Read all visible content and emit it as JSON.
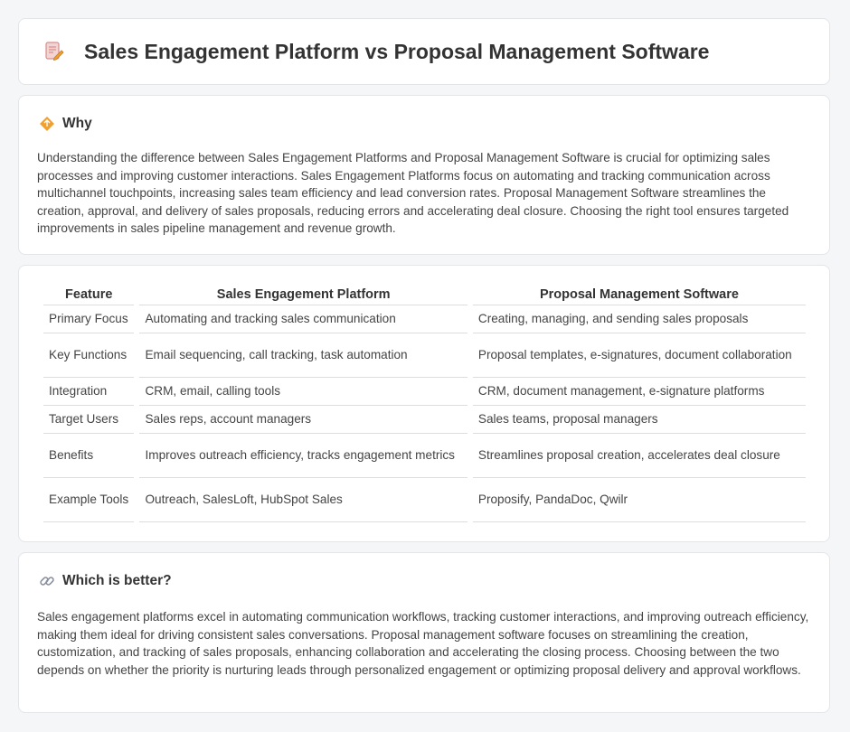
{
  "page": {
    "title": "Sales Engagement Platform vs Proposal Management Software"
  },
  "why": {
    "heading": "Why",
    "text": "Understanding the difference between Sales Engagement Platforms and Proposal Management Software is crucial for optimizing sales processes and improving customer interactions. Sales Engagement Platforms focus on automating and tracking communication across multichannel touchpoints, increasing sales team efficiency and lead conversion rates. Proposal Management Software streamlines the creation, approval, and delivery of sales proposals, reducing errors and accelerating deal closure. Choosing the right tool ensures targeted improvements in sales pipeline management and revenue growth."
  },
  "table": {
    "headers": [
      "Feature",
      "Sales Engagement Platform",
      "Proposal Management Software"
    ],
    "rows": [
      [
        "Primary Focus",
        "Automating and tracking sales communication",
        "Creating, managing, and sending sales proposals"
      ],
      [
        "Key Functions",
        "Email sequencing, call tracking, task automation",
        "Proposal templates, e-signatures, document collaboration"
      ],
      [
        "Integration",
        "CRM, email, calling tools",
        "CRM, document management, e-signature platforms"
      ],
      [
        "Target Users",
        "Sales reps, account managers",
        "Sales teams, proposal managers"
      ],
      [
        "Benefits",
        "Improves outreach efficiency, tracks engagement metrics",
        "Streamlines proposal creation, accelerates deal closure"
      ],
      [
        "Example Tools",
        "Outreach, SalesLoft, HubSpot Sales",
        "Proposify, PandaDoc, Qwilr"
      ]
    ]
  },
  "better": {
    "heading": "Which is better?",
    "text": "Sales engagement platforms excel in automating communication workflows, tracking customer interactions, and improving outreach efficiency, making them ideal for driving consistent sales conversations. Proposal management software focuses on streamlining the creation, customization, and tracking of sales proposals, enhancing collaboration and accelerating the closing process. Choosing between the two depends on whether the priority is nurturing leads through personalized engagement or optimizing proposal delivery and approval workflows."
  },
  "icons": {
    "title": "document-edit-icon",
    "why": "diamond-sign-icon",
    "better": "link-icon"
  },
  "colors": {
    "accent_orange": "#f0a030",
    "icon_pink": "#e46b6b"
  }
}
